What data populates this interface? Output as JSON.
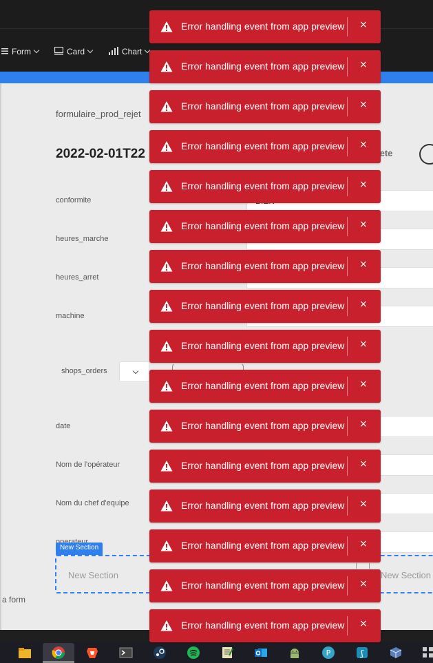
{
  "toolbar": {
    "items": [
      {
        "label": "Form",
        "icon": "list-icon"
      },
      {
        "label": "Card",
        "icon": "card-icon"
      },
      {
        "label": "Chart",
        "icon": "chart-icon"
      }
    ]
  },
  "page": {
    "breadcrumb": "formulaire_prod_rejet",
    "record_title": "2022-02-01T22",
    "delete_label": "lete",
    "fields": [
      {
        "label": "conformite",
        "value": "BIEN"
      },
      {
        "label": "heures_marche",
        "value": ""
      },
      {
        "label": "heures_arret",
        "value": ""
      },
      {
        "label": "machine",
        "value": ""
      },
      {
        "label": "date",
        "value": ""
      },
      {
        "label": "Nom de l'opérateur",
        "value": ""
      },
      {
        "label": "Nom du chef d'equipe",
        "value": ""
      },
      {
        "label": "operateur",
        "value": ""
      }
    ],
    "shops_orders_label": "shops_orders",
    "new_section_tag": "New Section",
    "new_section_placeholder": "New Section",
    "new_section_placeholder_right": "New Section",
    "a_form_text": "a form"
  },
  "toasts": {
    "message": "Error handling event from app preview",
    "close_symbol": "×",
    "count": 16
  },
  "colors": {
    "toast_bg": "#c9202e",
    "accent_blue": "#2f80ed",
    "app_bar": "#1c1c1c"
  },
  "taskbar": {
    "icons": [
      "file-explorer-icon",
      "chrome-icon",
      "brave-icon",
      "terminal-icon",
      "steam-icon",
      "spotify-icon",
      "notepad-icon",
      "outlook-icon",
      "android-icon",
      "teams-icon",
      "app-icon",
      "virtualbox-icon",
      "grid-icon"
    ]
  }
}
